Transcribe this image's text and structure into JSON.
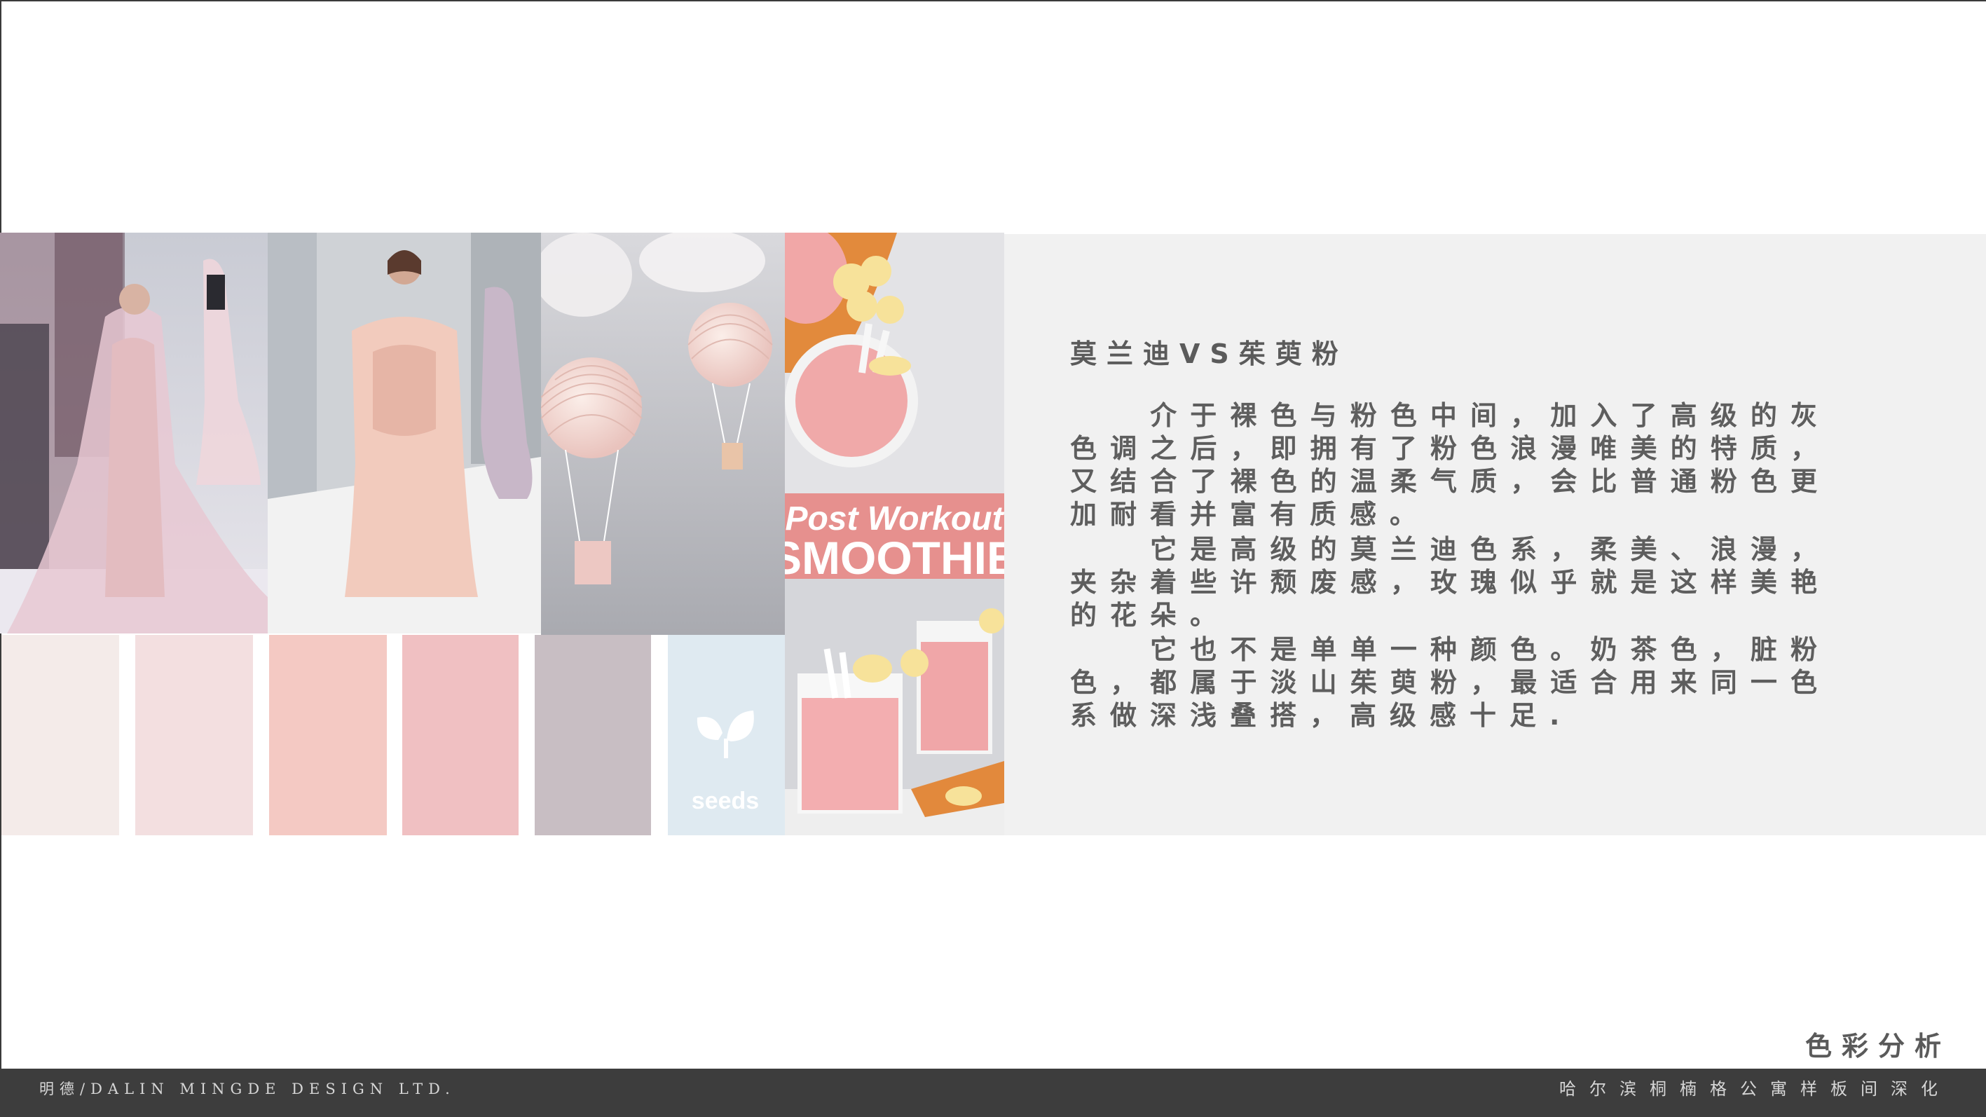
{
  "heading": "莫兰迪VS茱萸粉",
  "paragraphs": [
    "介于裸色与粉色中间，加入了高级的灰色调之后，即拥有了粉色浪漫唯美的特质，又结合了裸色的温柔气质，会比普通粉色更加耐看并富有质感。",
    "它是高级的莫兰迪色系，柔美、浪漫，夹杂着些许颓废感，玫瑰似乎就是这样美艳的花朵。",
    "它也不是单单一种颜色。奶茶色，脏粉色，都属于淡山茱萸粉，最适合用来同一色系做深浅叠搭，高级感十足."
  ],
  "section_label": "色彩分析",
  "footer": {
    "company": "明德/DALIN MINGDE DESIGN LTD.",
    "project": "哈尔滨桐楠格公寓样板间深化"
  },
  "smoothie_sign": {
    "line1": "Post Workout",
    "line2": "SMOOTHIE"
  },
  "seeds_logo": "seeds",
  "palette": [
    "#f4ebe9",
    "#f3dfe0",
    "#f4c9c3",
    "#f0c0c2",
    "#c8bec3",
    "#dfeaf1"
  ],
  "icons": [
    "seeds-leaf-icon"
  ]
}
